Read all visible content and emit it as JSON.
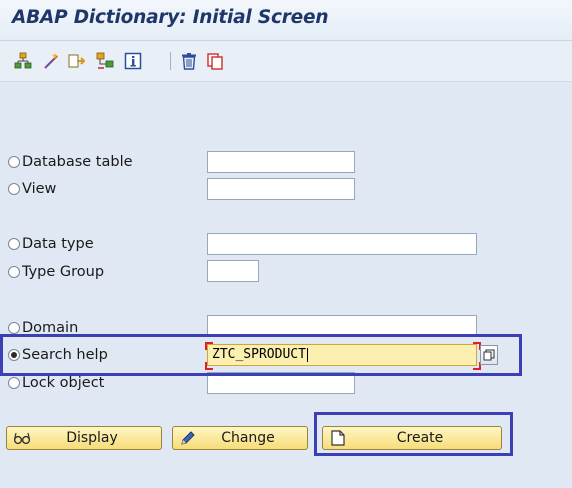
{
  "window": {
    "title": "ABAP Dictionary: Initial Screen"
  },
  "toolbar": {
    "icons": [
      "hierarchy-icon",
      "wand-icon",
      "other-object-icon",
      "where-used-icon",
      "info-icon",
      "delete-icon",
      "copy-icon"
    ]
  },
  "options": [
    {
      "label": "Database table",
      "value": "",
      "selected": false
    },
    {
      "label": "View",
      "value": "",
      "selected": false
    },
    {
      "label": "Data type",
      "value": "",
      "selected": false
    },
    {
      "label": "Type Group",
      "value": "",
      "selected": false
    },
    {
      "label": "Domain",
      "value": "",
      "selected": false
    },
    {
      "label": "Search help",
      "value": "ZTC_SPRODUCT",
      "selected": true
    },
    {
      "label": "Lock object",
      "value": "",
      "selected": false
    }
  ],
  "buttons": {
    "display": "Display",
    "change": "Change",
    "create": "Create"
  },
  "colors": {
    "highlight": "#3d3fb6",
    "title": "#1f3768",
    "button": "#f7dc7a"
  }
}
